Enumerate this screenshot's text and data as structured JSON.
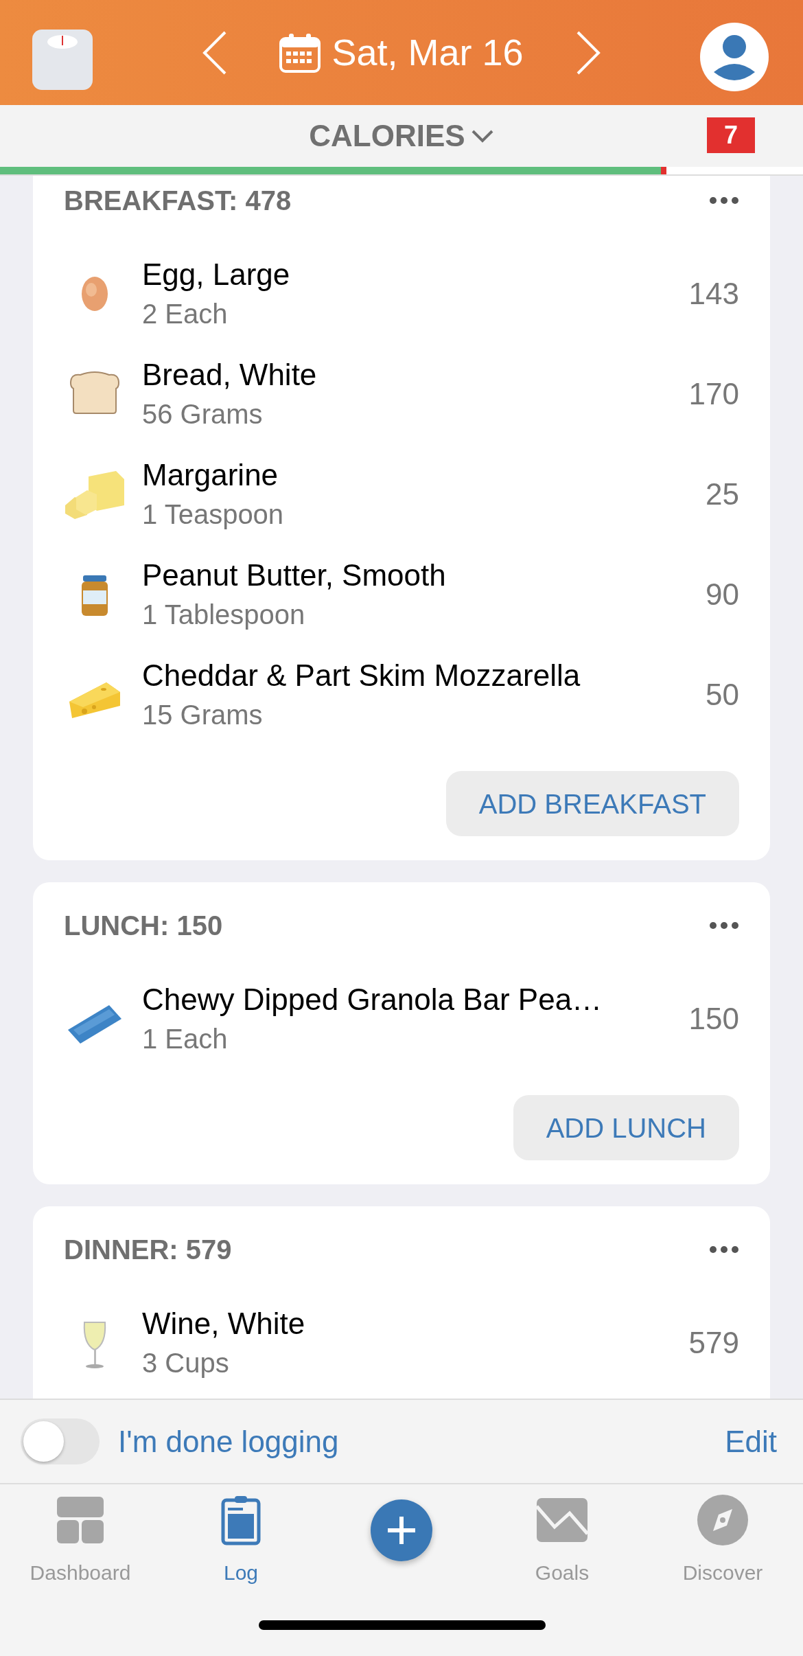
{
  "header": {
    "date": "Sat, Mar 16"
  },
  "summary": {
    "label": "CALORIES",
    "badge": "7",
    "level": 0.83
  },
  "meals": [
    {
      "title": "BREAKFAST: 478",
      "button": "ADD BREAKFAST",
      "items": [
        {
          "name": "Egg, Large",
          "amount": "2 Each",
          "calories": "143"
        },
        {
          "name": "Bread, White",
          "amount": "56 Grams",
          "calories": "170"
        },
        {
          "name": "Margarine",
          "amount": "1 Teaspoon",
          "calories": "25"
        },
        {
          "name": "Peanut Butter, Smooth",
          "amount": "1 Tablespoon",
          "calories": "90"
        },
        {
          "name": "Cheddar & Part Skim Mozzarella",
          "amount": "15 Grams",
          "calories": "50"
        }
      ]
    },
    {
      "title": "LUNCH: 150",
      "button": "ADD LUNCH",
      "items": [
        {
          "name": "Chewy Dipped Granola Bar Pea…",
          "amount": "1 Each",
          "calories": "150"
        }
      ]
    },
    {
      "title": "DINNER: 579",
      "items": [
        {
          "name": "Wine, White",
          "amount": "3 Cups",
          "calories": "579"
        }
      ]
    }
  ],
  "done_logging": {
    "label": "I'm done logging",
    "on": false,
    "edit": "Edit"
  },
  "tabs": [
    {
      "kind": "tab",
      "label": "Dashboard",
      "selected": false
    },
    {
      "kind": "tab",
      "label": "Log",
      "selected": true
    },
    {
      "kind": "add",
      "selected": false
    },
    {
      "kind": "tab",
      "label": "Goals",
      "selected": false
    },
    {
      "kind": "tab",
      "label": "Discover",
      "selected": false
    }
  ]
}
